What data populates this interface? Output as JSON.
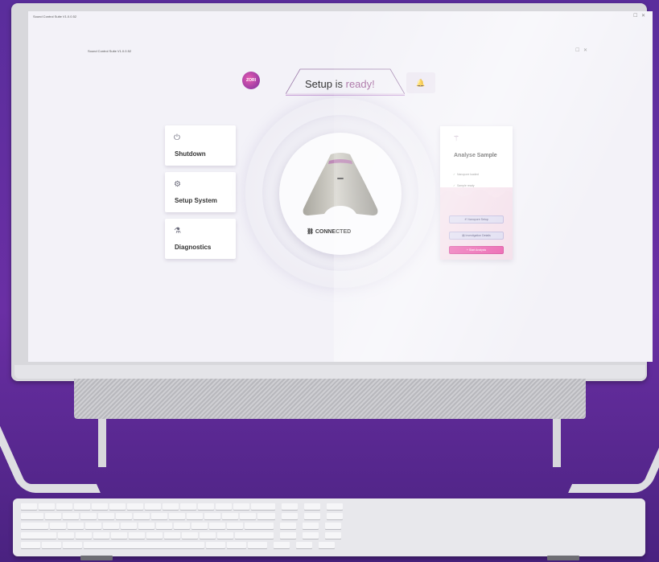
{
  "window": {
    "title": "Sound Control Suite V1.0.0.52",
    "inner_title": "Sound Control Suite V1.0.0.52",
    "ctrl_max": "☐",
    "ctrl_close": "✕"
  },
  "header": {
    "logo_text": "ZORI",
    "title_main": "Setup is",
    "title_accent": "ready!",
    "bell_icon": "bell-icon"
  },
  "menu": [
    {
      "label": "Shutdown",
      "icon": "power-icon",
      "glyph": "⏻"
    },
    {
      "label": "Setup System",
      "icon": "gear-icon",
      "glyph": "⚙"
    },
    {
      "label": "Diagnostics",
      "icon": "diagnostics-icon",
      "glyph": "⚗"
    }
  ],
  "device": {
    "status": "CONNECTED",
    "status_glyph": "⛓"
  },
  "panel": {
    "title": "Analyse Sample",
    "icon_glyph": "⚚",
    "checks": [
      "Nanopore loaded",
      "Sample ready"
    ],
    "buttons": {
      "nanopore": "⚟ Nanopore Setup",
      "investigation": "▤ Investigation Details",
      "start": "+ Start Analysis"
    }
  },
  "colors": {
    "accent": "#e94fa6",
    "brand_purple": "#7b2fa0",
    "background": "#5a2d9c"
  }
}
